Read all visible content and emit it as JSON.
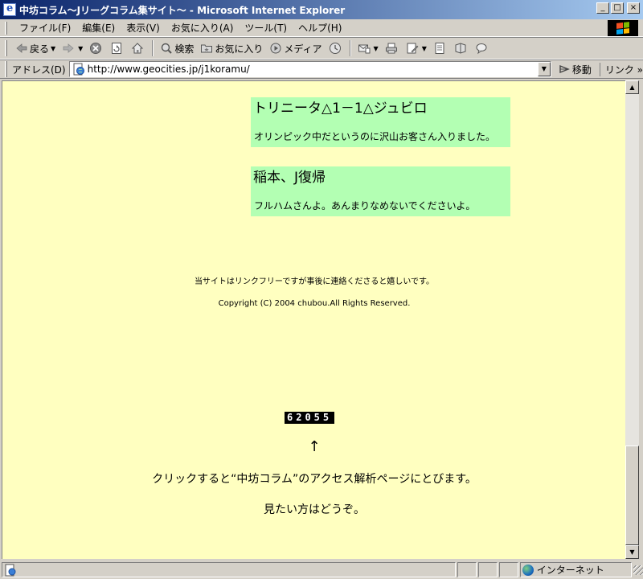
{
  "window": {
    "title": "中坊コラム～Jリーグコラム集サイト～ - Microsoft Internet Explorer",
    "min": "_",
    "max": "□",
    "close": "×"
  },
  "menubar": {
    "items": [
      "ファイル(F)",
      "編集(E)",
      "表示(V)",
      "お気に入り(A)",
      "ツール(T)",
      "ヘルプ(H)"
    ]
  },
  "toolbar": {
    "back": "戻る",
    "search": "検索",
    "favorites": "お気に入り",
    "media": "メディア"
  },
  "addressbar": {
    "label": "アドレス(D)",
    "url": "http://www.geocities.jp/j1koramu/",
    "go": "移動",
    "links": "リンク"
  },
  "content": {
    "news": [
      {
        "title": "トリニータ△1－1△ジュビロ",
        "body": "オリンピック中だというのに沢山お客さん入りました。"
      },
      {
        "title": "稲本、J復帰",
        "body": "フルハムさんよ。あんまりなめないでくださいよ。"
      }
    ],
    "link_free_note": "当サイトはリンクフリーですが事後に連絡くださると嬉しいです。",
    "copyright": "Copyright (C) 2004 chubou.All Rights Reserved.",
    "counter": "62055",
    "arrow": "↑",
    "access_line1": "クリックすると“中坊コラム”のアクセス解析ページにとびます。",
    "access_line2": "見たい方はどうぞ。"
  },
  "statusbar": {
    "zone": "インターネット"
  }
}
